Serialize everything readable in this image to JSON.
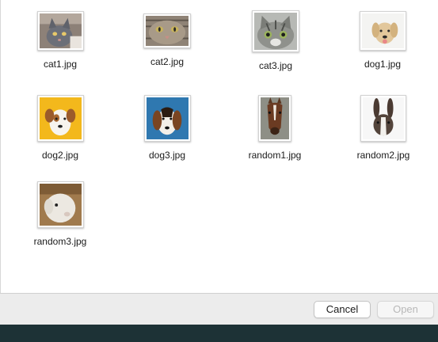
{
  "files": [
    {
      "name": "cat1.jpg",
      "icon": "cat-photo-icon"
    },
    {
      "name": "cat2.jpg",
      "icon": "cat-photo-icon"
    },
    {
      "name": "cat3.jpg",
      "icon": "cat-photo-icon"
    },
    {
      "name": "dog1.jpg",
      "icon": "dog-photo-icon"
    },
    {
      "name": "dog2.jpg",
      "icon": "dog-photo-icon"
    },
    {
      "name": "dog3.jpg",
      "icon": "dog-photo-icon"
    },
    {
      "name": "random1.jpg",
      "icon": "horse-photo-icon"
    },
    {
      "name": "random2.jpg",
      "icon": "rabbit-photo-icon"
    },
    {
      "name": "random3.jpg",
      "icon": "sheep-photo-icon"
    }
  ],
  "buttons": {
    "cancel_label": "Cancel",
    "open_label": "Open"
  },
  "colors": {
    "button_bar": "#ececec",
    "bottom_strip": "#1d3236",
    "disabled_text": "#b8b8b8"
  }
}
